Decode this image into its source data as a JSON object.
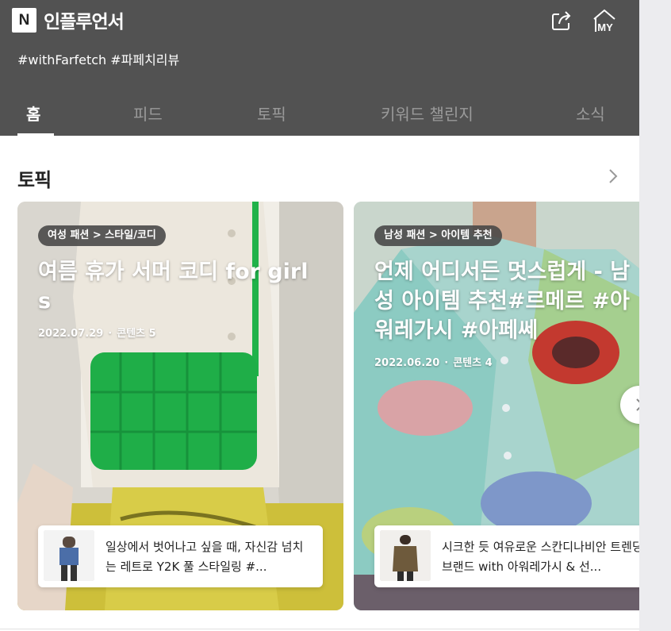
{
  "header": {
    "logo_letter": "N",
    "brand": "인플루언서",
    "hashtags": "#withFarfetch #파페치리뷰",
    "my_label": "MY"
  },
  "tabs": [
    {
      "label": "홈",
      "active": true
    },
    {
      "label": "피드"
    },
    {
      "label": "토픽"
    },
    {
      "label": "키워드 챌린지"
    },
    {
      "label": "소식"
    }
  ],
  "section": {
    "title": "토픽"
  },
  "cards": [
    {
      "category": "여성 패션 > 스타일/코디",
      "title": "여름 휴가 서머 코디 for girls",
      "date": "2022.07.29",
      "count": "콘텐츠 5",
      "preview_text": "일상에서 벗어나고 싶을 때, 자신감 넘치는 레트로 Y2K 풀 스타일링 #..."
    },
    {
      "category": "남성 패션 > 아이템 추천",
      "title": "언제 어디서든 멋스럽게 - 남성 아이템 추천#르메르 #아워레가시 #아페쎄",
      "date": "2022.06.20",
      "count": "콘텐츠 4",
      "preview_text": "시크한 듯 여유로운 스칸디나비안 트렌딩 브랜드 with 아워레가시 & 선..."
    }
  ],
  "colors": {
    "header_bg": "#525252",
    "bag_green": "#20b24a"
  }
}
